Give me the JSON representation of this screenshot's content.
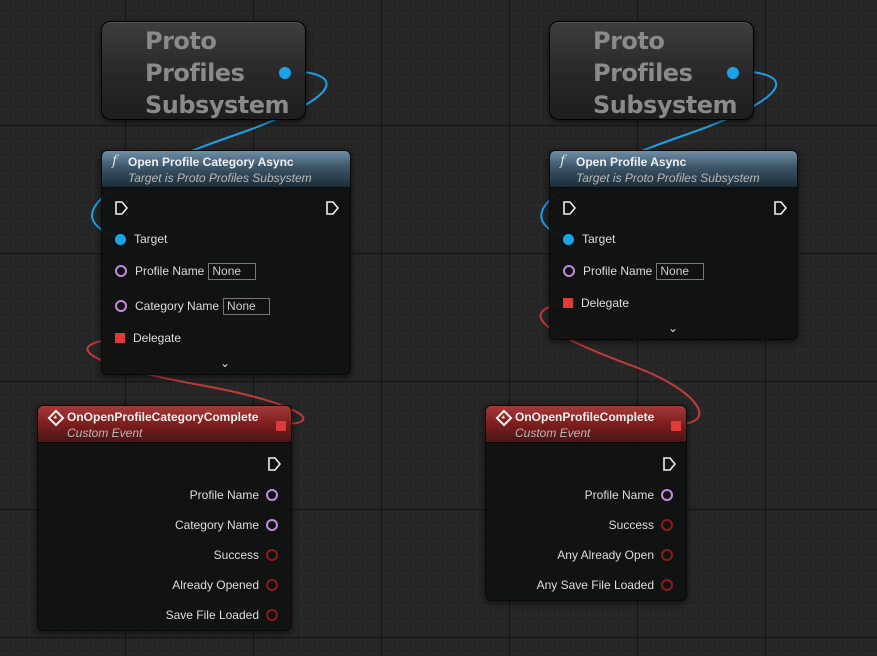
{
  "left": {
    "var_node": {
      "title": "Proto Profiles Subsystem"
    },
    "func_node": {
      "title": "Open Profile Category Async",
      "subtitle": "Target is Proto Profiles Subsystem",
      "target_label": "Target",
      "profile_name_label": "Profile Name",
      "profile_name_value": "None",
      "category_name_label": "Category Name",
      "category_name_value": "None",
      "delegate_label": "Delegate"
    },
    "event_node": {
      "title": "OnOpenProfileCategoryComplete",
      "subtitle": "Custom Event",
      "outputs": [
        "Profile Name",
        "Category Name",
        "Success",
        "Already Opened",
        "Save File Loaded"
      ]
    }
  },
  "right": {
    "var_node": {
      "title": "Proto Profiles Subsystem"
    },
    "func_node": {
      "title": "Open Profile Async",
      "subtitle": "Target is Proto Profiles Subsystem",
      "target_label": "Target",
      "profile_name_label": "Profile Name",
      "profile_name_value": "None",
      "delegate_label": "Delegate"
    },
    "event_node": {
      "title": "OnOpenProfileComplete",
      "subtitle": "Custom Event",
      "outputs": [
        "Profile Name",
        "Success",
        "Any Already Open",
        "Any Save File Loaded"
      ]
    }
  },
  "icons": {
    "function": "function-icon",
    "event": "event-icon",
    "exec": "exec-pin-icon",
    "expand": "chevron-down-icon"
  },
  "colors": {
    "object_pin": "#1aa3e8",
    "name_pin": "#c38bdc",
    "bool_pin": "#8b1a1a",
    "delegate_pin": "#e03a3a",
    "function_header": "#3c5568",
    "event_header": "#7d1e1e"
  }
}
